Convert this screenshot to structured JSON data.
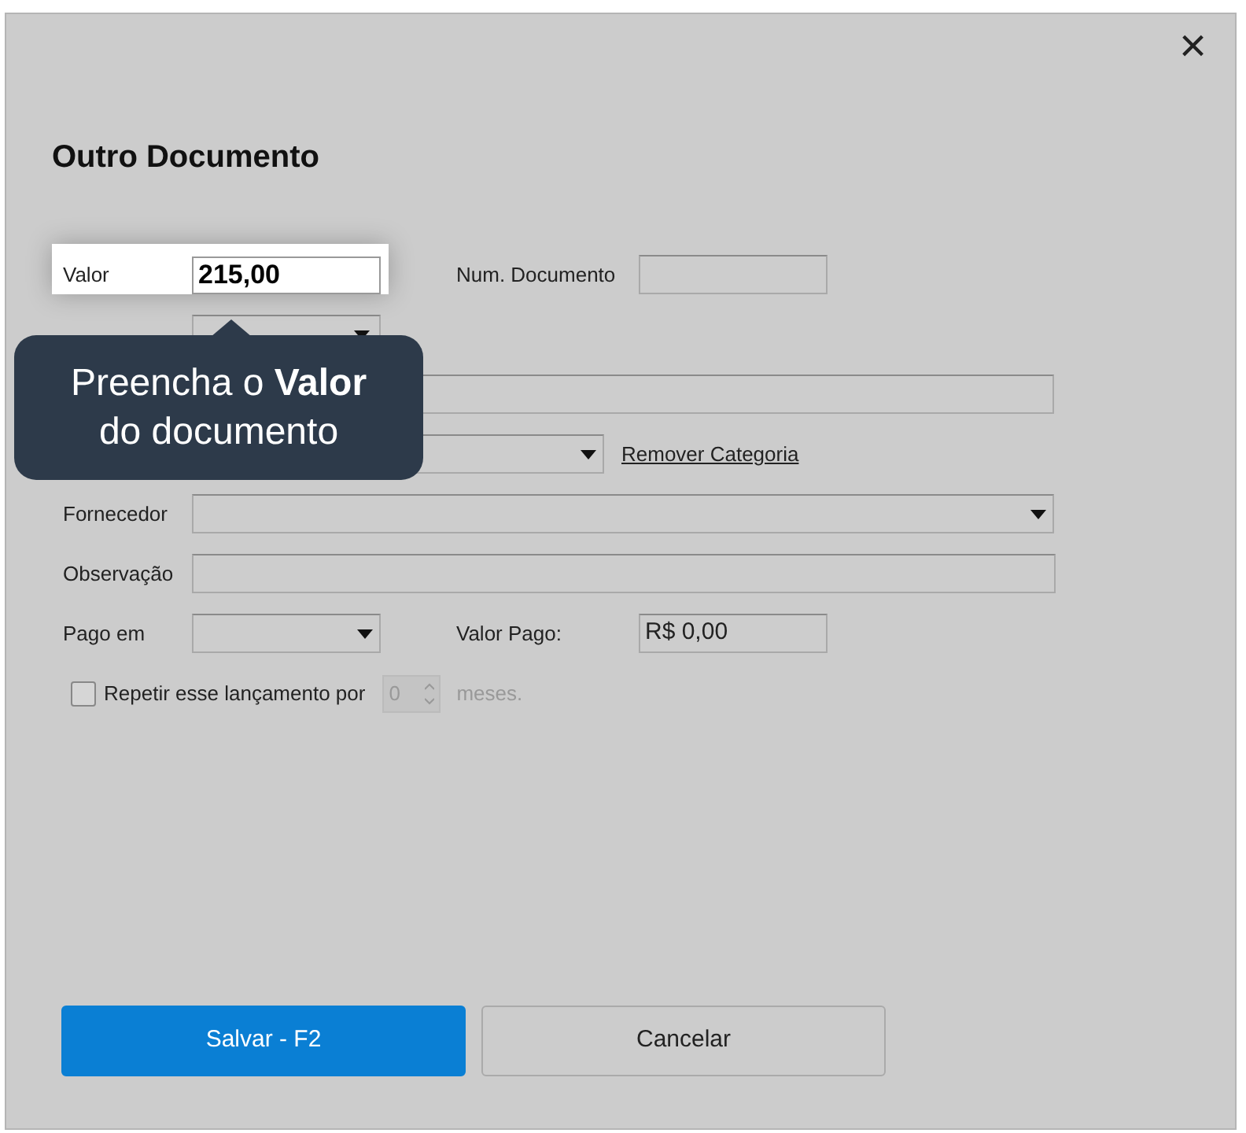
{
  "dialog": {
    "title": "Outro Documento",
    "close": "×"
  },
  "fields": {
    "valor": {
      "label": "Valor",
      "value": "215,00"
    },
    "num_documento": {
      "label": "Num. Documento"
    },
    "remover_categoria": "Remover Categoria",
    "fornecedor": {
      "label": "Fornecedor"
    },
    "observacao": {
      "label": "Observação"
    },
    "pago_em": {
      "label": "Pago em"
    },
    "valor_pago": {
      "label": "Valor Pago:",
      "value": "R$ 0,00"
    },
    "repetir": {
      "label": "Repetir esse lançamento por",
      "checked": false,
      "count": "0",
      "unit": "meses."
    }
  },
  "tooltip": "Preencha o **Valor** do documento",
  "buttons": [
    {
      "label": "Salvar - F2",
      "kind": "primary"
    },
    {
      "label": "Cancelar",
      "kind": "secondary"
    }
  ]
}
